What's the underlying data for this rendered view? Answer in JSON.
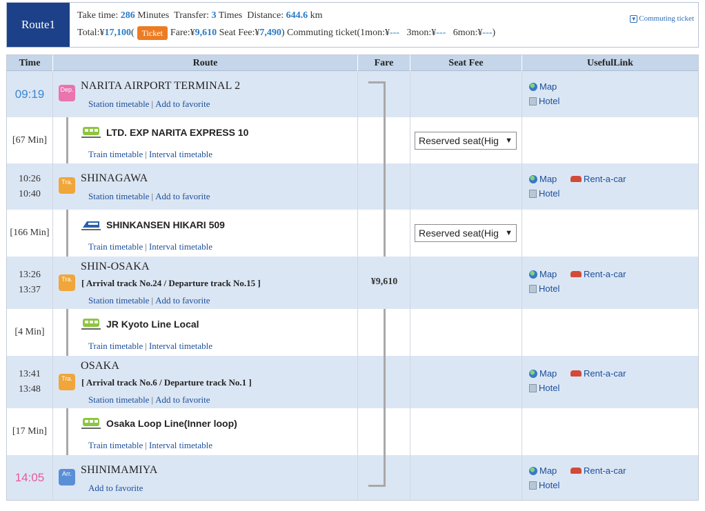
{
  "summary": {
    "route_label": "Route1",
    "take_time_label": "Take time:",
    "take_time_value": "286",
    "minutes_label": "Minutes",
    "transfer_label": "Transfer:",
    "transfer_value": "3",
    "times_label": "Times",
    "distance_label": "Distance:",
    "distance_value": "644.6",
    "km_label": "km",
    "total_label": "Total:¥",
    "total_value": "17,100",
    "open_paren": "(",
    "ticket_label": "Ticket",
    "fare_label": "Fare:¥",
    "fare_value": "9,610",
    "seat_fee_label": "Seat Fee:¥",
    "seat_fee_value": "7,490",
    "close_paren": ")",
    "commute_text": "Commuting ticket(1mon:¥",
    "commute_1mon": "---",
    "commute_3mon_label": "3mon:¥",
    "commute_3mon": "---",
    "commute_6mon_label": "6mon:¥",
    "commute_6mon": "---",
    "commute_end": ")",
    "commuting_ticket_link": "Commuting ticket"
  },
  "table": {
    "headers": [
      "Time",
      "Route",
      "Fare",
      "Seat Fee",
      "UsefulLink"
    ]
  },
  "stations": [
    {
      "time1": "09:19",
      "time2": "",
      "icon": "Dep.",
      "name": "NARITA AIRPORT TERMINAL 2",
      "sub": "",
      "link1": "Station timetable",
      "link2": "Add to favorite",
      "map": "Map",
      "hotel": "Hotel",
      "rent": ""
    },
    {
      "time1": "10:26",
      "time2": "10:40",
      "icon": "Tra.",
      "name": "SHINAGAWA",
      "sub": "",
      "link1": "Station timetable",
      "link2": "Add to favorite",
      "map": "Map",
      "hotel": "Hotel",
      "rent": "Rent-a-car"
    },
    {
      "time1": "13:26",
      "time2": "13:37",
      "icon": "Tra.",
      "name": "SHIN-OSAKA",
      "sub": "[ Arrival track No.24 / Departure track No.15 ]",
      "link1": "Station timetable",
      "link2": "Add to favorite",
      "map": "Map",
      "hotel": "Hotel",
      "rent": "Rent-a-car",
      "fare": "¥9,610"
    },
    {
      "time1": "13:41",
      "time2": "13:48",
      "icon": "Tra.",
      "name": "OSAKA",
      "sub": "[ Arrival track No.6 / Departure track No.1 ]",
      "link1": "Station timetable",
      "link2": "Add to favorite",
      "map": "Map",
      "hotel": "Hotel",
      "rent": "Rent-a-car"
    },
    {
      "time1": "14:05",
      "time2": "",
      "icon": "Arr.",
      "name": "SHINIMAMIYA",
      "sub": "",
      "link1": "",
      "link2": "Add to favorite",
      "map": "Map",
      "hotel": "Hotel",
      "rent": "Rent-a-car"
    }
  ],
  "sections": [
    {
      "duration": "[67 Min]",
      "train": "LTD. EXP NARITA EXPRESS 10",
      "link1": "Train timetable",
      "link2": "Interval timetable",
      "seat": "Reserved seat(Hig"
    },
    {
      "duration": "[166 Min]",
      "train": "SHINKANSEN HIKARI 509",
      "link1": "Train timetable",
      "link2": "Interval timetable",
      "seat": "Reserved seat(Hig"
    },
    {
      "duration": "[4 Min]",
      "train": "JR Kyoto Line Local",
      "link1": "Train timetable",
      "link2": "Interval timetable",
      "seat": ""
    },
    {
      "duration": "[17 Min]",
      "train": "Osaka Loop Line(Inner loop)",
      "link1": "Train timetable",
      "link2": "Interval timetable",
      "seat": ""
    }
  ],
  "colors": {
    "route_badge": "#1d4189",
    "ticket_badge": "#ec7c24",
    "header_bg": "#c5d6ea",
    "station_row_bg": "#dbe6f4",
    "departure_time": "#3a87d0",
    "arrival_time": "#e8589a"
  },
  "icons": [
    "commuting-ticket-icon",
    "departure-icon",
    "transfer-icon",
    "arrival-icon",
    "train-icon",
    "shinkansen-icon",
    "globe-icon",
    "hotel-icon",
    "car-icon",
    "dropdown-arrow-icon"
  ]
}
